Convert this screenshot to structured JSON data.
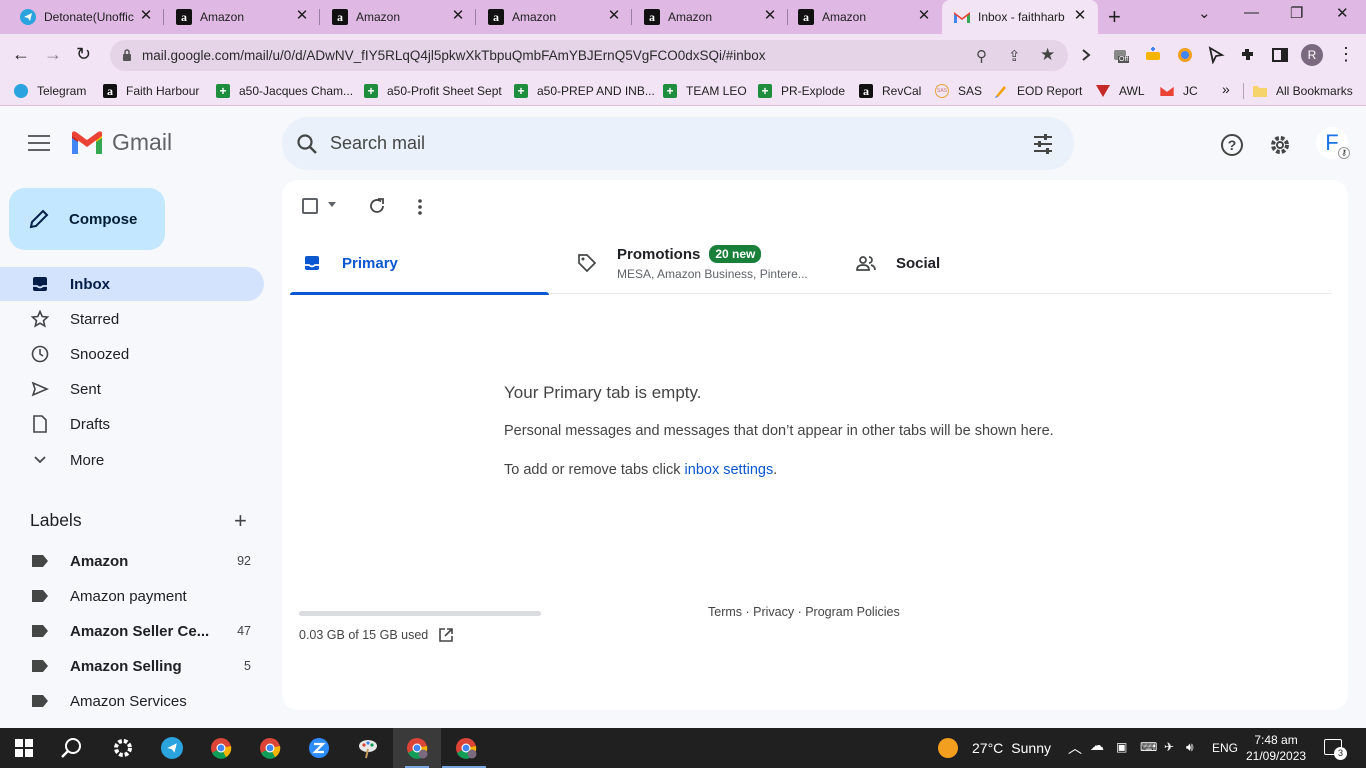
{
  "browser": {
    "tabs": [
      {
        "title": "Detonate(Unoffic",
        "icon": "telegram-icon"
      },
      {
        "title": "Amazon",
        "icon": "amazon-icon"
      },
      {
        "title": "Amazon",
        "icon": "amazon-icon"
      },
      {
        "title": "Amazon",
        "icon": "amazon-icon"
      },
      {
        "title": "Amazon",
        "icon": "amazon-icon"
      },
      {
        "title": "Amazon",
        "icon": "amazon-icon"
      },
      {
        "title": "Inbox - faithharb",
        "icon": "gmail-icon",
        "active": true
      }
    ],
    "url": "mail.google.com/mail/u/0/d/ADwNV_fIY5RLqQ4jl5pkwXkTbpuQmbFAmYBJErnQ5VgFCO0dxSQi/#inbox",
    "profile_initial": "R",
    "bookmarks": [
      "Telegram",
      "Faith Harbour",
      "a50-Jacques Cham...",
      "a50-Profit Sheet Sept",
      "a50-PREP AND INB...",
      "TEAM LEO",
      "PR-Explode",
      "RevCal",
      "SAS",
      "EOD Report",
      "AWL",
      "JC"
    ],
    "more_bookmarks": "»",
    "all_bookmarks": "All Bookmarks",
    "ext_badge": "Off"
  },
  "gmail": {
    "brand": "Gmail",
    "search_placeholder": "Search mail",
    "avatar_initial": "F",
    "compose": "Compose",
    "nav": [
      {
        "label": "Inbox",
        "icon": "inbox-icon",
        "active": true
      },
      {
        "label": "Starred",
        "icon": "star-icon"
      },
      {
        "label": "Snoozed",
        "icon": "clock-icon"
      },
      {
        "label": "Sent",
        "icon": "send-icon"
      },
      {
        "label": "Drafts",
        "icon": "draft-icon"
      },
      {
        "label": "More",
        "icon": "chevron-down-icon"
      }
    ],
    "labels_heading": "Labels",
    "labels": [
      {
        "name": "Amazon",
        "count": "92",
        "bold": true
      },
      {
        "name": "Amazon payment",
        "count": "",
        "bold": false
      },
      {
        "name": "Amazon Seller Ce...",
        "count": "47",
        "bold": true
      },
      {
        "name": "Amazon Selling",
        "count": "5",
        "bold": true
      },
      {
        "name": "Amazon Services",
        "count": "",
        "bold": false
      }
    ],
    "tabs": {
      "primary": "Primary",
      "promotions": "Promotions",
      "promotions_badge": "20 new",
      "promotions_sub": "MESA, Amazon Business, Pintere...",
      "social": "Social"
    },
    "empty": {
      "title": "Your Primary tab is empty.",
      "body": "Personal messages and messages that don’t appear in other tabs will be shown here.",
      "settings_prefix": "To add or remove tabs click ",
      "settings_link": "inbox settings",
      "settings_suffix": "."
    },
    "storage": "0.03 GB of 15 GB used",
    "footer": "Terms · Privacy · Program Policies"
  },
  "taskbar": {
    "weather_temp": "27°C",
    "weather_desc": "Sunny",
    "lang": "ENG",
    "time": "7:48 am",
    "date": "21/09/2023",
    "notifications": "3"
  },
  "colors": {
    "accent": "#0b57d0",
    "compose": "#c2e7ff",
    "active_nav": "#d3e3fd",
    "badge": "#188038",
    "tabstrip": "#dfb9e4"
  }
}
